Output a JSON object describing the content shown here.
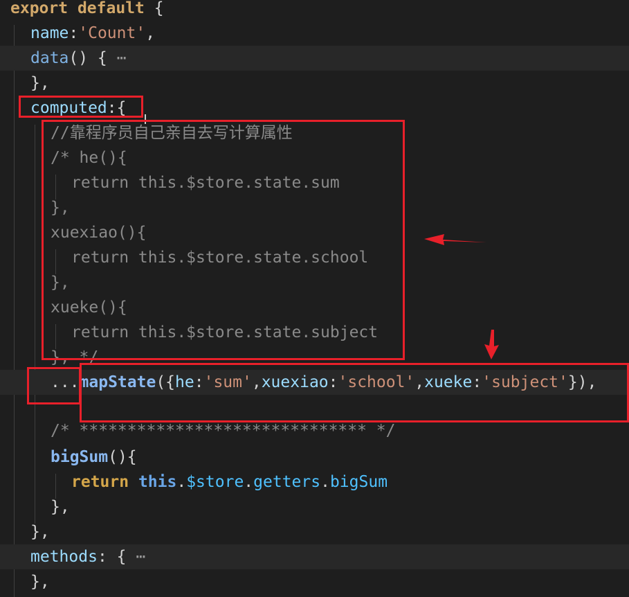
{
  "editor": {
    "lines": [
      {
        "id": "l1",
        "tokens": [
          [
            "kw",
            "export"
          ],
          [
            "punc",
            " "
          ],
          [
            "kw",
            "default"
          ],
          [
            "punc",
            " {"
          ]
        ]
      },
      {
        "id": "l2",
        "tokens": [
          [
            "prop",
            "name"
          ],
          [
            "punc",
            ":"
          ],
          [
            "str",
            "'Count'"
          ],
          [
            "punc",
            ","
          ]
        ]
      },
      {
        "id": "l3",
        "tokens": [
          [
            "fn",
            "data"
          ],
          [
            "punc",
            "() {"
          ],
          [
            "fold",
            " ⋯"
          ]
        ]
      },
      {
        "id": "l4",
        "tokens": [
          [
            "punc",
            "},"
          ]
        ]
      },
      {
        "id": "l5",
        "tokens": [
          [
            "prop",
            "computed"
          ],
          [
            "punc",
            ":{"
          ]
        ]
      },
      {
        "id": "l6",
        "tokens": [
          [
            "cmt",
            "//靠程序员自己亲自去写计算属性"
          ]
        ]
      },
      {
        "id": "l7",
        "tokens": [
          [
            "cmt",
            "/* he(){"
          ]
        ]
      },
      {
        "id": "l8",
        "tokens": [
          [
            "cmt",
            "return this.$store.state.sum"
          ]
        ]
      },
      {
        "id": "l9",
        "tokens": [
          [
            "cmt",
            "},"
          ]
        ]
      },
      {
        "id": "l10",
        "tokens": [
          [
            "cmt",
            "xuexiao(){"
          ]
        ]
      },
      {
        "id": "l11",
        "tokens": [
          [
            "cmt",
            "return this.$store.state.school"
          ]
        ]
      },
      {
        "id": "l12",
        "tokens": [
          [
            "cmt",
            "},"
          ]
        ]
      },
      {
        "id": "l13",
        "tokens": [
          [
            "cmt",
            "xueke(){"
          ]
        ]
      },
      {
        "id": "l14",
        "tokens": [
          [
            "cmt",
            "return this.$store.state.subject"
          ]
        ]
      },
      {
        "id": "l15",
        "tokens": [
          [
            "cmt",
            "}, */"
          ]
        ]
      },
      {
        "id": "l16",
        "tokens": [
          [
            "punc",
            "..."
          ],
          [
            "fnb",
            "mapState"
          ],
          [
            "punc",
            "({"
          ],
          [
            "prop",
            "he"
          ],
          [
            "punc",
            ":"
          ],
          [
            "str",
            "'sum'"
          ],
          [
            "punc",
            ","
          ],
          [
            "prop",
            "xuexiao"
          ],
          [
            "punc",
            ":"
          ],
          [
            "str",
            "'school'"
          ],
          [
            "punc",
            ","
          ],
          [
            "prop",
            "xueke"
          ],
          [
            "punc",
            ":"
          ],
          [
            "str",
            "'subject'"
          ],
          [
            "punc",
            "}),"
          ]
        ]
      },
      {
        "id": "l17",
        "tokens": []
      },
      {
        "id": "l18",
        "tokens": [
          [
            "cmt",
            "/* ****************************** */"
          ]
        ]
      },
      {
        "id": "l19",
        "tokens": [
          [
            "fnb",
            "bigSum"
          ],
          [
            "punc",
            "(){"
          ]
        ]
      },
      {
        "id": "l20",
        "tokens": [
          [
            "ret",
            "return"
          ],
          [
            "punc",
            " "
          ],
          [
            "this",
            "this"
          ],
          [
            "punc",
            "."
          ],
          [
            "store",
            "$store"
          ],
          [
            "punc",
            "."
          ],
          [
            "store",
            "getters"
          ],
          [
            "punc",
            "."
          ],
          [
            "store",
            "bigSum"
          ]
        ]
      },
      {
        "id": "l21",
        "tokens": [
          [
            "punc",
            "},"
          ]
        ]
      },
      {
        "id": "l22",
        "tokens": [
          [
            "punc",
            "},"
          ]
        ]
      },
      {
        "id": "l23",
        "tokens": [
          [
            "prop",
            "methods"
          ],
          [
            "punc",
            ": {"
          ],
          [
            "fold",
            " ⋯"
          ]
        ]
      },
      {
        "id": "l24",
        "tokens": [
          [
            "punc",
            "},"
          ]
        ]
      }
    ]
  },
  "colors": {
    "background": "#1e1e1e",
    "annotation": "#e8202a"
  }
}
